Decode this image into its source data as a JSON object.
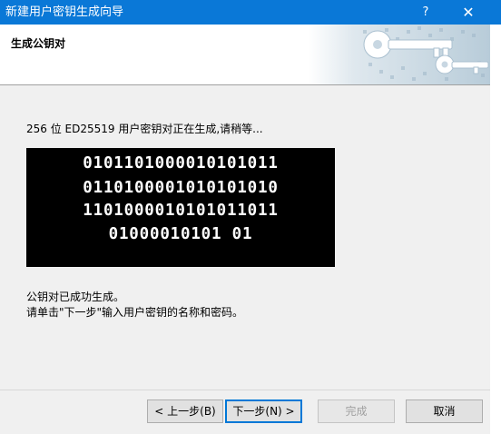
{
  "window": {
    "title": "新建用户密钥生成向导",
    "help_label": "?",
    "close_label": "✕"
  },
  "header": {
    "title": "生成公钥对"
  },
  "main": {
    "status_text": "256 位 ED25519 用户密钥对正在生成,请稍等...",
    "key_lines": [
      "0101101000010101011",
      "0110100001010101010",
      "1101000010101011011",
      "01000010101 01"
    ],
    "done_text": "公钥对已成功生成。",
    "instruction_text": "请单击\"下一步\"输入用户密钥的名称和密码。"
  },
  "buttons": {
    "back": "< 上一步(B)",
    "next": "下一步(N) >",
    "finish": "完成",
    "cancel": "取消"
  },
  "colors": {
    "titlebar": "#0a78d7",
    "accent_border": "#0078d7"
  }
}
